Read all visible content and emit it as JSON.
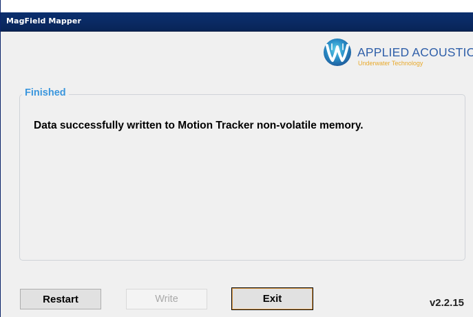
{
  "window": {
    "title": "MagField Mapper"
  },
  "logo": {
    "name": "APPLIED ACOUSTICS",
    "tagline": "Underwater Technology",
    "brand_blue": "#2f5fa9",
    "brand_orange": "#e8a92b"
  },
  "group": {
    "title": "Finished",
    "message": "Data successfully written to Motion Tracker non-volatile memory."
  },
  "buttons": {
    "restart_label": "Restart",
    "write_label": "Write",
    "exit_label": "Exit"
  },
  "version": "v2.2.15",
  "colors": {
    "titlebar": "#0a2a63",
    "group_title": "#3a96dd",
    "window_bg": "#f0f0f0"
  }
}
